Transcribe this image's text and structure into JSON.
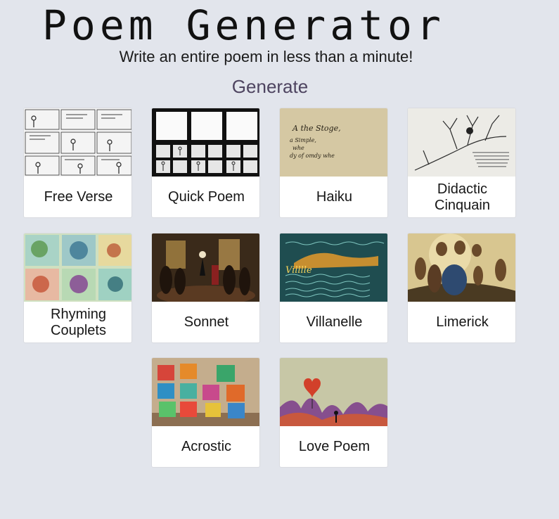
{
  "header": {
    "title": "Poem Generator",
    "subtitle": "Write an entire poem in less than a minute!",
    "generate_label": "Generate"
  },
  "cards": [
    {
      "label": "Free Verse"
    },
    {
      "label": "Quick Poem"
    },
    {
      "label": "Haiku",
      "image_text": [
        "A the Stoge,",
        "a Simple,",
        "whe",
        "dy of omdy whe"
      ]
    },
    {
      "label": "Didactic Cinquain"
    },
    {
      "label": "Rhyming Couplets"
    },
    {
      "label": "Sonnet"
    },
    {
      "label": "Villanelle",
      "image_text": [
        "Villlle"
      ]
    },
    {
      "label": "Limerick"
    },
    {
      "label": "Acrostic"
    },
    {
      "label": "Love Poem"
    }
  ]
}
